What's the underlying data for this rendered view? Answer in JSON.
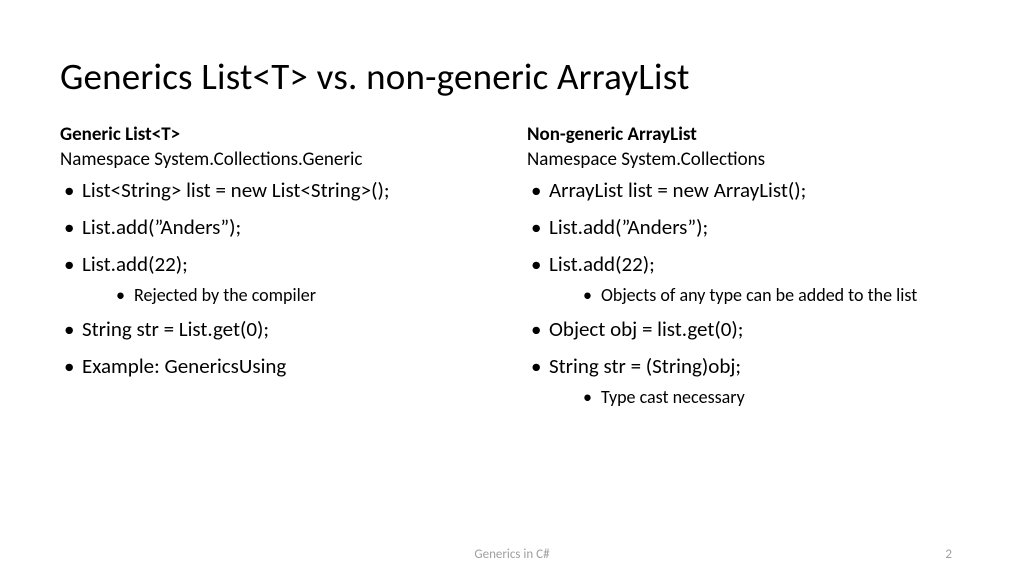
{
  "title": "Generics List<T> vs. non-generic ArrayList",
  "left": {
    "heading": "Generic List<T>",
    "namespace": "Namespace System.Collections.Generic",
    "items": [
      {
        "text": "List<String> list = new List<String>();"
      },
      {
        "text": "List.add(”Anders”);"
      },
      {
        "text": "List.add(22);",
        "sub": [
          "Rejected by the compiler"
        ]
      },
      {
        "text": "String str = List.get(0);"
      },
      {
        "text": "Example: GenericsUsing"
      }
    ]
  },
  "right": {
    "heading": "Non-generic ArrayList",
    "namespace": "Namespace System.Collections",
    "items": [
      {
        "text": "ArrayList list = new ArrayList();"
      },
      {
        "text": "List.add(”Anders”);"
      },
      {
        "text": "List.add(22);",
        "sub": [
          "Objects of any type can be added to the list"
        ]
      },
      {
        "text": "Object obj = list.get(0);"
      },
      {
        "text": "String str = (String)obj;",
        "sub": [
          "Type cast necessary"
        ]
      }
    ]
  },
  "footer": "Generics in C#",
  "page": "2"
}
